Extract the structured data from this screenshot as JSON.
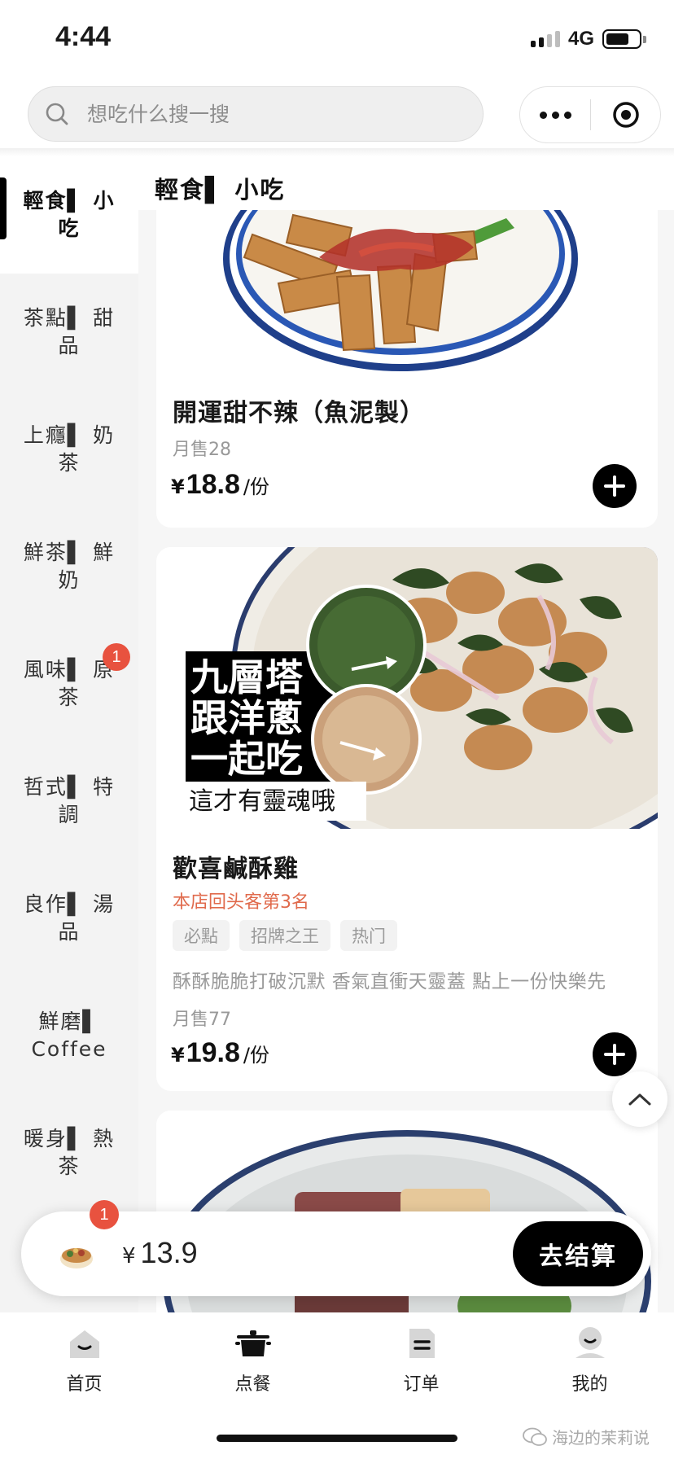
{
  "status": {
    "time": "4:44",
    "network": "4G"
  },
  "search": {
    "placeholder": "想吃什么搜一搜"
  },
  "sidebar": {
    "items": [
      {
        "line1": "輕食▌ 小",
        "line2": "吃",
        "active": true
      },
      {
        "line1": "茶點▌ 甜",
        "line2": "品"
      },
      {
        "line1": "上癮▌ 奶",
        "line2": "茶"
      },
      {
        "line1": "鮮茶▌ 鮮",
        "line2": "奶"
      },
      {
        "line1": "風味▌ 原",
        "line2": "茶",
        "badge": "1"
      },
      {
        "line1": "哲式▌ 特",
        "line2": "調"
      },
      {
        "line1": "良作▌ 湯",
        "line2": "品"
      },
      {
        "line1": "鮮磨▌",
        "line2": "Coffee"
      },
      {
        "line1": "暖身▌ 熱",
        "line2": "茶"
      }
    ]
  },
  "section": {
    "title": "輕食▌ 小吃"
  },
  "products": [
    {
      "name": "開運甜不辣（魚泥製）",
      "monthly_sales": "月售28",
      "currency": "¥",
      "price": "18.8",
      "unit": "/份"
    },
    {
      "name": "歡喜鹹酥雞",
      "rank": "本店回头客第3名",
      "tags": [
        "必點",
        "招牌之王",
        "热门"
      ],
      "description": "酥酥脆脆打破沉默 香氣直衝天靈蓋 點上一份快樂先",
      "monthly_sales": "月售77",
      "currency": "¥",
      "price": "19.8",
      "unit": "/份",
      "image_text": {
        "line1": "九層塔",
        "line2": "跟洋蔥",
        "line3": "一起吃",
        "caption": "這才有靈魂哦"
      }
    }
  ],
  "cart": {
    "badge": "1",
    "currency": "¥",
    "total": "13.9",
    "checkout_label": "去结算"
  },
  "tabs": [
    {
      "label": "首页"
    },
    {
      "label": "点餐"
    },
    {
      "label": "订单"
    },
    {
      "label": "我的"
    }
  ],
  "watermark": "海边的茉莉说",
  "colors": {
    "accent": "#000000",
    "badge": "#e8523f",
    "rank": "#e06a4c",
    "sidebar_bg": "#f3f3f3"
  }
}
